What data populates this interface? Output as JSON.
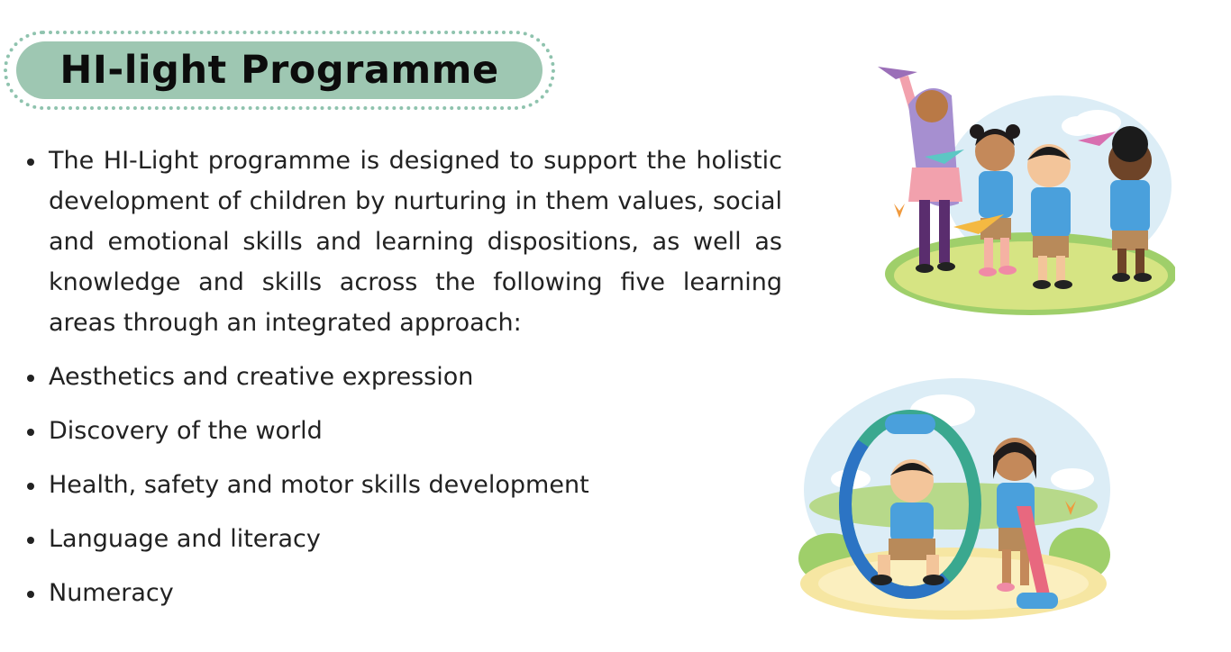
{
  "title": "HI-light Programme",
  "intro": "The HI-Light programme is designed to support the holistic development of children by nurturing in them values, social and emotional skills and learning dispositions, as well as knowledge and skills across the following five learning areas through an integrated approach:",
  "learning_areas": [
    "Aesthetics and creative expression",
    "Discovery of the world",
    "Health, safety and motor skills development",
    "Language and literacy",
    "Numeracy"
  ],
  "colors": {
    "title_pill": "#9ec7b2",
    "title_border": "#8fc3ae",
    "uniform_blue": "#4aa0dc",
    "grass": "#cfe27c",
    "sky": "#d8ecf6"
  }
}
